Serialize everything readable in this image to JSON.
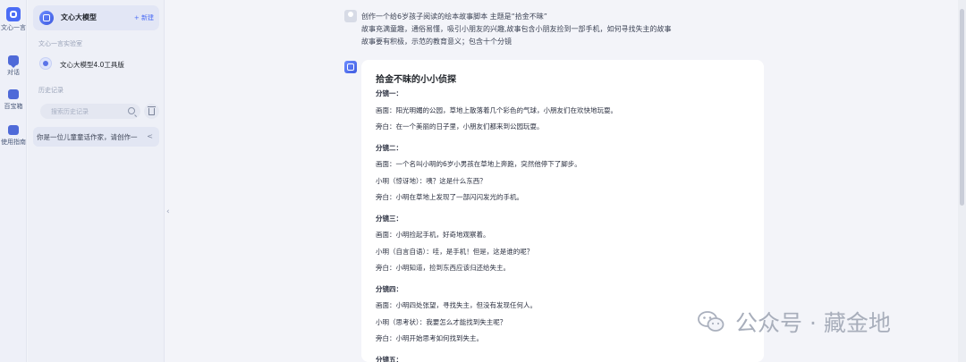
{
  "rail": {
    "logo_label": "文心一言",
    "chat_label": "对话",
    "box_label": "百宝箱",
    "guide_label": "使用指南"
  },
  "sidebar": {
    "model_name": "文心大模型",
    "new_label": "+ 新建",
    "lab_label": "文心一言实验室",
    "tool_name": "文心大模型4.0工具版",
    "history_label": "历史记录",
    "search_placeholder": "搜索历史记录",
    "history_items": [
      "你是一位儿童童话作家，请创作一"
    ]
  },
  "chat": {
    "prompt_lines": [
      "创作一个给6岁孩子阅读的绘本故事脚本 主题是“拾金不昧”",
      "故事充满童趣，通俗易懂，吸引小朋友的兴趣,故事包含小朋友捡到一部手机，如何寻找失主的故事",
      "故事要有积极，示范的教育意义；包含十个分镜"
    ],
    "response_title": "拾金不昧的小小侦探",
    "response_lines": [
      {
        "text": "分镜一：",
        "heading": true
      },
      {
        "text": "画面：阳光明媚的公园，草地上散落着几个彩色的气球，小朋友们在欢快地玩耍。",
        "heading": false
      },
      {
        "text": "旁白：在一个美丽的日子里，小朋友们都来到公园玩耍。",
        "heading": false
      },
      {
        "text": "分镜二：",
        "heading": true
      },
      {
        "text": "画面：一个名叫小明的6岁小男孩在草地上奔跑，突然他停下了脚步。",
        "heading": false
      },
      {
        "text": "小明（惊讶地）：咦？这是什么东西？",
        "heading": false
      },
      {
        "text": "旁白：小明在草地上发现了一部闪闪发光的手机。",
        "heading": false
      },
      {
        "text": "分镜三：",
        "heading": true
      },
      {
        "text": "画面：小明捡起手机，好奇地观察着。",
        "heading": false
      },
      {
        "text": "小明（自言自语）：哇，是手机！但是，这是谁的呢？",
        "heading": false
      },
      {
        "text": "旁白：小明知道，捡到东西应该归还给失主。",
        "heading": false
      },
      {
        "text": "分镜四：",
        "heading": true
      },
      {
        "text": "画面：小明四处张望，寻找失主，但没有发现任何人。",
        "heading": false
      },
      {
        "text": "小明（思考状）：我要怎么才能找到失主呢？",
        "heading": false
      },
      {
        "text": "旁白：小明开始思考如何找到失主。",
        "heading": false
      },
      {
        "text": "分镜五：",
        "heading": true
      }
    ]
  },
  "watermark": {
    "text": "公众号 · 藏金地"
  }
}
